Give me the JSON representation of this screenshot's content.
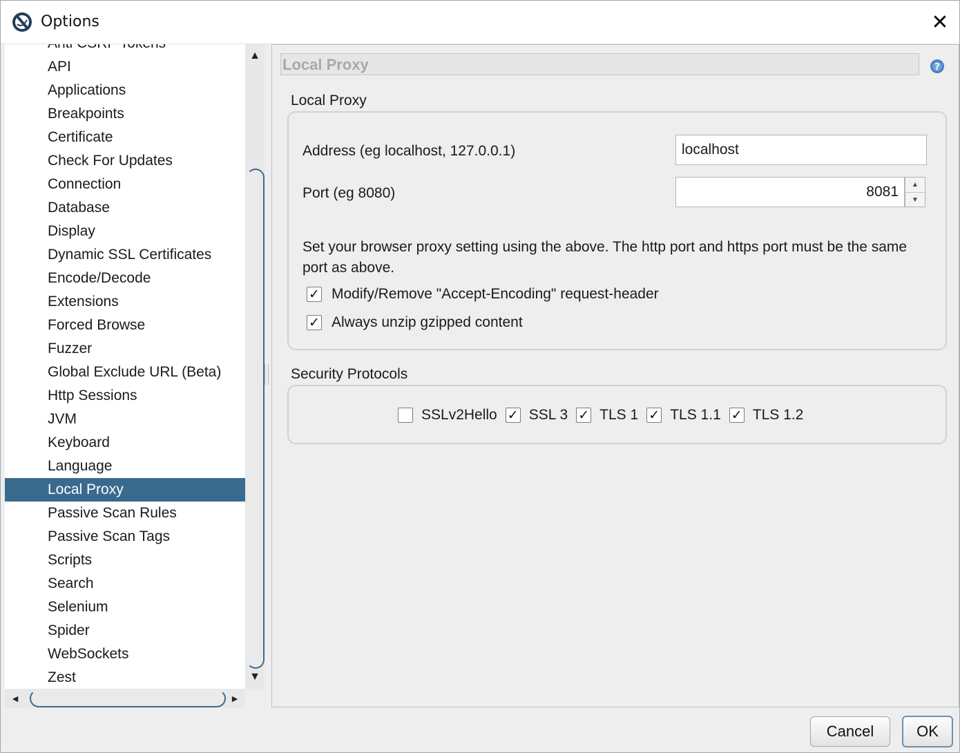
{
  "window": {
    "title": "Options",
    "close_glyph": "✕"
  },
  "tree": {
    "cut_item": "Anti CSRF Tokens",
    "items": [
      "API",
      "Applications",
      "Breakpoints",
      "Certificate",
      "Check For Updates",
      "Connection",
      "Database",
      "Display",
      "Dynamic SSL Certificates",
      "Encode/Decode",
      "Extensions",
      "Forced Browse",
      "Fuzzer",
      "Global Exclude URL (Beta)",
      "Http Sessions",
      "JVM",
      "Keyboard",
      "Language",
      "Local Proxy",
      "Passive Scan Rules",
      "Passive Scan Tags",
      "Scripts",
      "Search",
      "Selenium",
      "Spider",
      "WebSockets",
      "Zest"
    ],
    "selected": "Local Proxy"
  },
  "scrollbars": {
    "up": "▲",
    "down": "▼",
    "left": "◄",
    "right": "►"
  },
  "panel": {
    "header": "Local Proxy",
    "local_proxy_group": {
      "label": "Local Proxy",
      "address_label": "Address (eg localhost, 127.0.0.1)",
      "address_value": "localhost",
      "port_label": "Port (eg 8080)",
      "port_value": "8081",
      "spinner_up": "▲",
      "spinner_down": "▼",
      "info_text": "Set your browser proxy setting using the above. The http port and https port must be the same port as above.",
      "checkbox_accept_encoding": {
        "label": "Modify/Remove \"Accept-Encoding\" request-header",
        "checked": true
      },
      "checkbox_unzip": {
        "label": "Always unzip gzipped content",
        "checked": true
      }
    },
    "security_group": {
      "label": "Security Protocols",
      "protocols": [
        {
          "label": "SSLv2Hello",
          "checked": false
        },
        {
          "label": "SSL 3",
          "checked": true
        },
        {
          "label": "TLS 1",
          "checked": true
        },
        {
          "label": "TLS 1.1",
          "checked": true
        },
        {
          "label": "TLS 1.2",
          "checked": true
        }
      ]
    }
  },
  "check_glyph": "✓",
  "buttons": {
    "cancel": "Cancel",
    "ok": "OK"
  },
  "colors": {
    "selection": "#3a6a8e",
    "scroll_accent": "#3c6a90",
    "help_icon": "#4a7fc0"
  }
}
